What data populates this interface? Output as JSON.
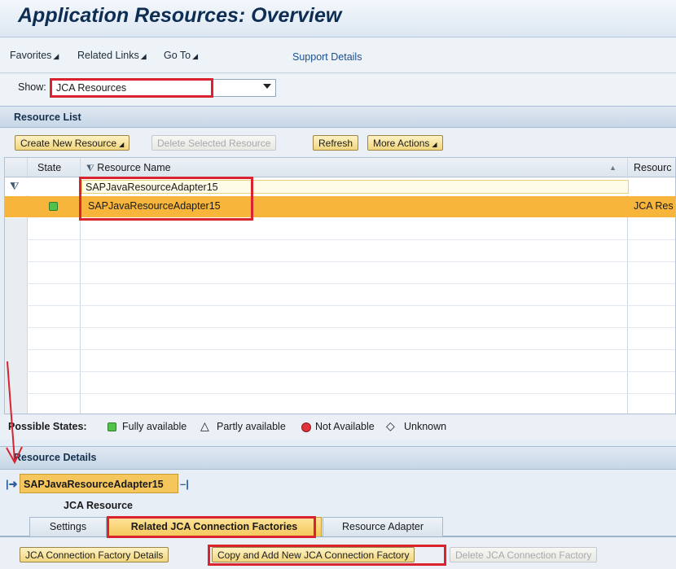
{
  "title": "Application Resources: Overview",
  "menu": {
    "items": [
      "Favorites",
      "Related Links",
      "Go To"
    ],
    "support": "Support Details"
  },
  "show": {
    "label": "Show:",
    "value": "JCA Resources"
  },
  "resource_list": {
    "heading": "Resource List",
    "buttons": {
      "create": "Create New Resource",
      "delete": "Delete Selected Resource",
      "refresh": "Refresh",
      "more": "More Actions"
    },
    "columns": {
      "state": "State",
      "name": "Resource Name",
      "type": "Resourc"
    },
    "filter_value": "SAPJavaResourceAdapter15",
    "rows": [
      {
        "state": "Fully available",
        "name": "SAPJavaResourceAdapter15",
        "type": "JCA Res"
      }
    ]
  },
  "possible_states": {
    "label": "Possible States:",
    "fully": "Fully available",
    "partly": "Partly available",
    "not": "Not Available",
    "unknown": "Unknown"
  },
  "resource_details": {
    "heading": "Resource Details",
    "name": "SAPJavaResourceAdapter15",
    "type": "JCA Resource",
    "tabs": [
      "Settings",
      "Related JCA Connection Factories",
      "Resource Adapter"
    ],
    "active_tab": "Related JCA Connection Factories",
    "buttons": {
      "details": "JCA Connection Factory Details",
      "copy_add": "Copy and Add New JCA Connection Factory",
      "delete": "Delete JCA Connection Factory"
    }
  },
  "colors": {
    "accent": "#f7b63b",
    "highlight": "#d9232e",
    "status_green": "#52c34a"
  },
  "icons": [
    "filter-icon",
    "sort-ascending-icon",
    "dropdown-arrow-icon",
    "status-green-icon",
    "status-yellow-triangle-icon",
    "status-red-icon",
    "status-unknown-diamond-icon",
    "expand-arrow-icon",
    "collapse-icon"
  ]
}
